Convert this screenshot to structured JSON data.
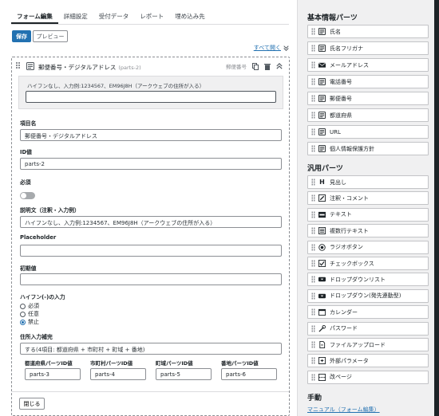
{
  "tabs": [
    "フォーム編集",
    "詳細設定",
    "受付データ",
    "レポート",
    "埋め込み先"
  ],
  "toolbar": {
    "save_label": "保存",
    "preview_label": "プレビュー",
    "open_all_label": "すべて開く"
  },
  "card": {
    "title": "郵便番号・デジタルアドレス",
    "id_tag": "(parts-2)",
    "type_label": "郵便番号",
    "preview_description": "ハイフンなし、入力例:1234567、EM96J8H（アークウェブの住所が入る）",
    "fields": {
      "item_name_label": "項目名",
      "item_name_value": "郵便番号・デジタルアドレス",
      "id_label": "ID値",
      "id_value": "parts-2",
      "required_label": "必須",
      "required_on": false,
      "description_label": "説明文（注釈・入力例）",
      "description_value": "ハイフンなし、入力例:1234567、EM96J8H（アークウェブの住所が入る）",
      "placeholder_label": "Placeholder",
      "placeholder_value": "",
      "initial_label": "初期値",
      "initial_value": "",
      "hyphen_label": "ハイフン(-)の入力",
      "hyphen_options": [
        "必須",
        "任意",
        "禁止"
      ],
      "hyphen_selected": "禁止",
      "address_label": "住所入力補完",
      "address_value": "する(4項目: 都道府県 + 市町村 + 町域 + 番地)",
      "sub_fields": [
        {
          "label": "都道府県パーツID値",
          "value": "parts-3"
        },
        {
          "label": "市町村パーツID値",
          "value": "parts-4"
        },
        {
          "label": "町域パーツID値",
          "value": "parts-5"
        },
        {
          "label": "番地パーツID値",
          "value": "parts-6"
        }
      ]
    },
    "close_label": "閉じる"
  },
  "sidebar": {
    "basic_title": "基本情報パーツ",
    "basic_parts": [
      {
        "label": "氏名",
        "icon": "id-card-icon"
      },
      {
        "label": "氏名フリガナ",
        "icon": "id-card-icon"
      },
      {
        "label": "メールアドレス",
        "icon": "envelope-icon"
      },
      {
        "label": "電話番号",
        "icon": "id-card-icon"
      },
      {
        "label": "郵便番号",
        "icon": "id-card-icon"
      },
      {
        "label": "都道府県",
        "icon": "id-card-icon"
      },
      {
        "label": "URL",
        "icon": "id-card-icon"
      },
      {
        "label": "個人情報保護方針",
        "icon": "id-card-icon"
      }
    ],
    "general_title": "汎用パーツ",
    "general_parts": [
      {
        "label": "見出し",
        "icon": "heading-icon"
      },
      {
        "label": "注釈・コメント",
        "icon": "note-icon"
      },
      {
        "label": "テキスト",
        "icon": "text-icon"
      },
      {
        "label": "複数行テキスト",
        "icon": "textarea-icon"
      },
      {
        "label": "ラジオボタン",
        "icon": "radio-icon"
      },
      {
        "label": "チェックボックス",
        "icon": "checkbox-icon"
      },
      {
        "label": "ドロップダウンリスト",
        "icon": "dropdown-icon"
      },
      {
        "label": "ドロップダウン(発先連動型)",
        "icon": "dropdown-icon"
      },
      {
        "label": "カレンダー",
        "icon": "calendar-icon"
      },
      {
        "label": "パスワード",
        "icon": "password-icon"
      },
      {
        "label": "ファイルアップロード",
        "icon": "file-icon"
      },
      {
        "label": "外部パラメータ",
        "icon": "param-icon"
      },
      {
        "label": "改ページ",
        "icon": "pagebreak-icon"
      }
    ],
    "help_title": "手動",
    "manual_link": "マニュアル（フォーム編集）"
  },
  "colors": {
    "accent": "#2271b1",
    "background": "#f0f0f1"
  }
}
